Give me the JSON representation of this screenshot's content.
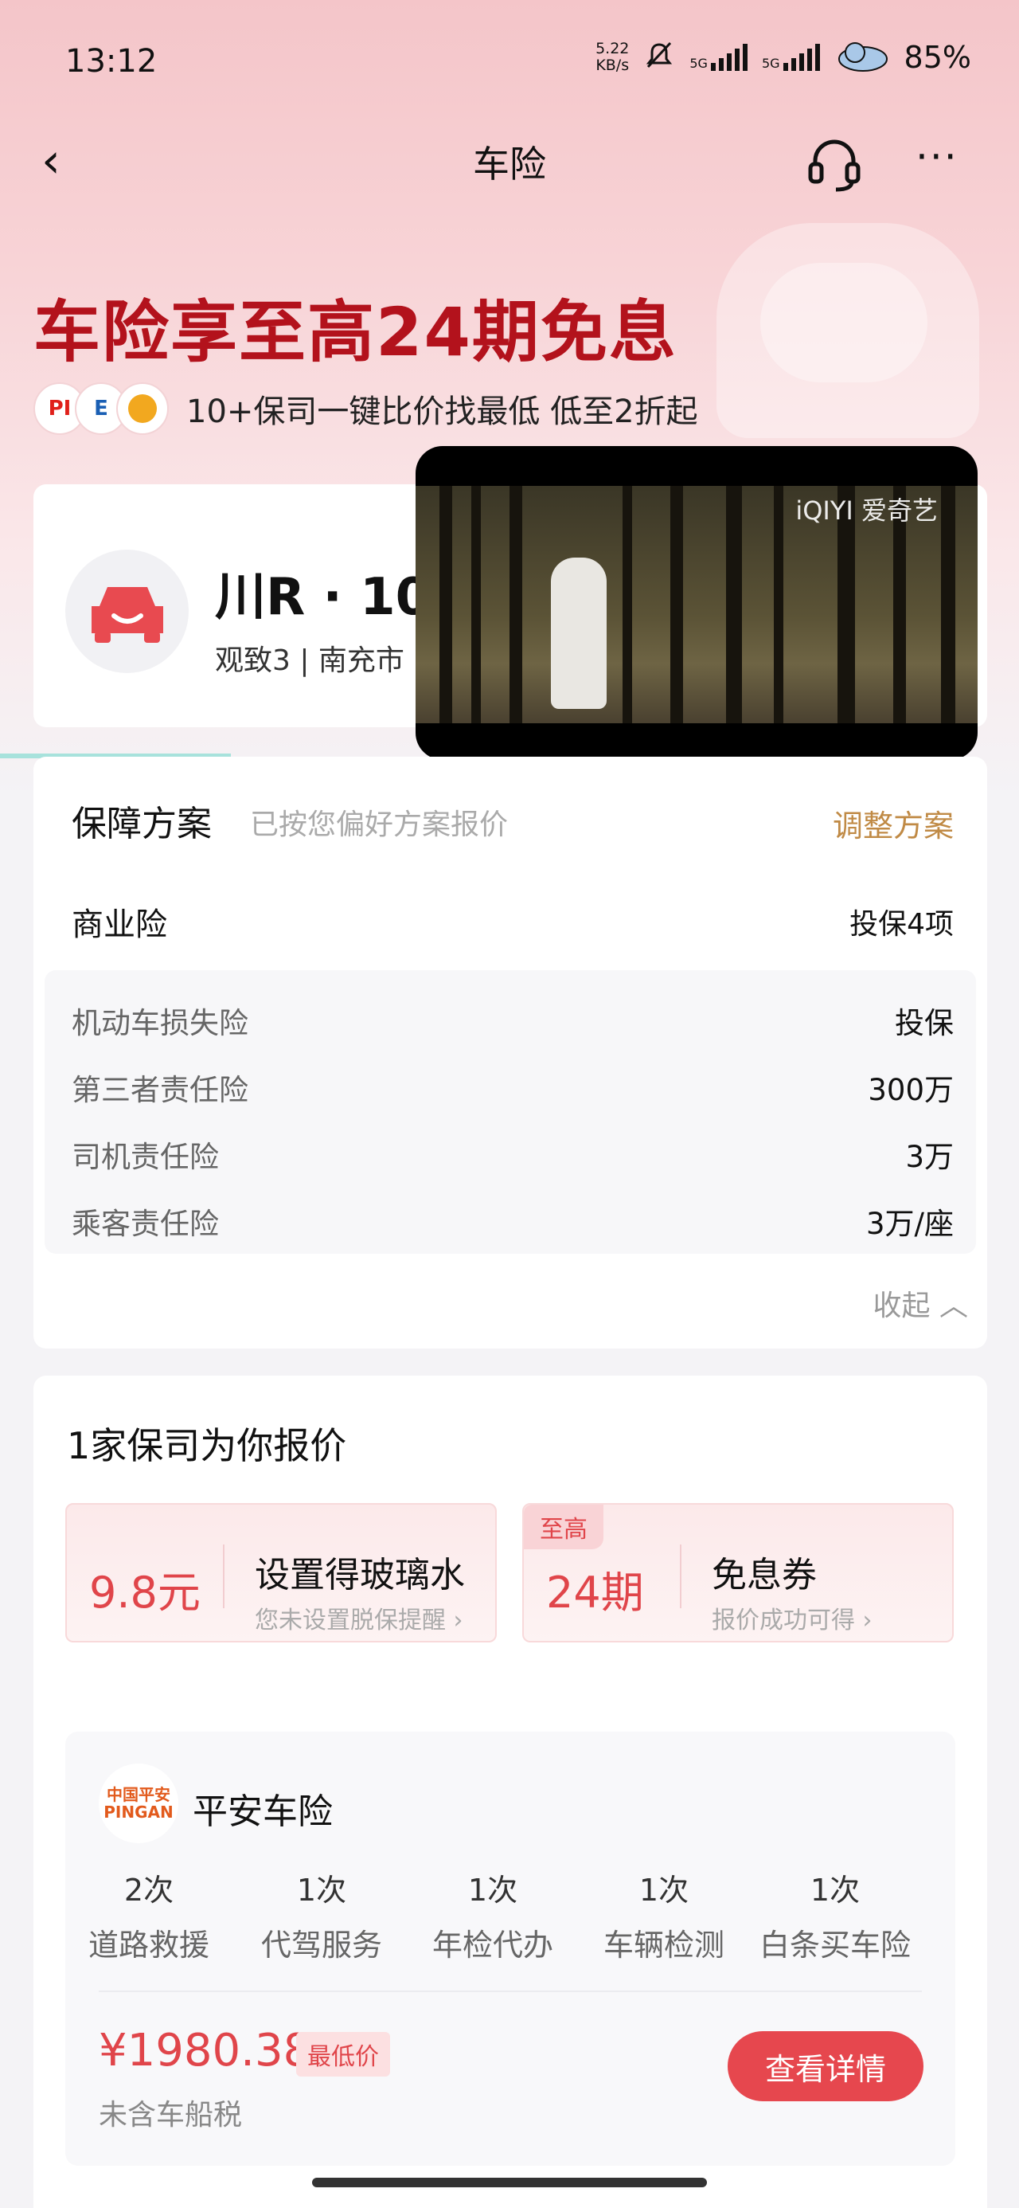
{
  "status": {
    "time": "13:12",
    "speed_value": "5.22",
    "speed_unit": "KB/s",
    "net1": "5G",
    "net2": "5G",
    "battery": "85%"
  },
  "nav": {
    "back": "‹",
    "title": "车险",
    "more": "···"
  },
  "banner": {
    "headline": "车险享至高24期免息",
    "subtitle": "10+保司一键比价找最低 低至2折起",
    "logos": [
      "PI",
      "E",
      ""
    ]
  },
  "vehicle": {
    "plate": "川R · 10",
    "model": "观致3 | 南充市"
  },
  "video": {
    "logo": "iQIYI 爱奇艺"
  },
  "plan": {
    "title": "保障方案",
    "subtitle": "已按您偏好方案报价",
    "adjust": "调整方案",
    "business_label": "商业险",
    "business_value": "投保4项",
    "items": [
      {
        "name": "机动车损失险",
        "value": "投保"
      },
      {
        "name": "第三者责任险",
        "value": "300万"
      },
      {
        "name": "司机责任险",
        "value": "3万"
      },
      {
        "name": "乘客责任险",
        "value": "3万/座"
      }
    ],
    "collapse": "收起 ︿"
  },
  "quote": {
    "title": "1家保司为你报价",
    "promos": [
      {
        "big": "9.8元",
        "title": "设置得玻璃水",
        "sub": "您未设置脱保提醒 ›",
        "tag": ""
      },
      {
        "big": "24期",
        "title": "免息券",
        "sub": "报价成功可得 ›",
        "tag": "至高"
      }
    ],
    "insurer": {
      "logo_top": "中国平安",
      "logo_bottom": "PINGAN",
      "name": "平安车险",
      "services": [
        {
          "count": "2次",
          "label": "道路救援"
        },
        {
          "count": "1次",
          "label": "代驾服务"
        },
        {
          "count": "1次",
          "label": "年检代办"
        },
        {
          "count": "1次",
          "label": "车辆检测"
        },
        {
          "count": "1次",
          "label": "白条买车险"
        }
      ],
      "price": "¥1980.38",
      "price_tag": "最低价",
      "tax_note": "未含车船税",
      "button": "查看详情"
    }
  }
}
